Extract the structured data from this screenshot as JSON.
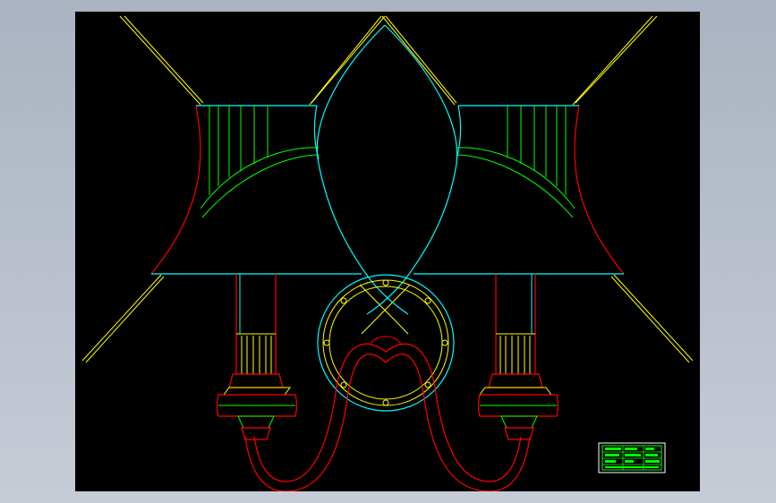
{
  "drawing": {
    "background": "#000000",
    "colors": {
      "construction": "#ffff00",
      "outline": "#00ffff",
      "shade_pleats": "#00ff00",
      "profile": "#ff0000",
      "frame": "#808080"
    },
    "title_block": {
      "rows": [
        "",
        "",
        "",
        ""
      ]
    }
  }
}
